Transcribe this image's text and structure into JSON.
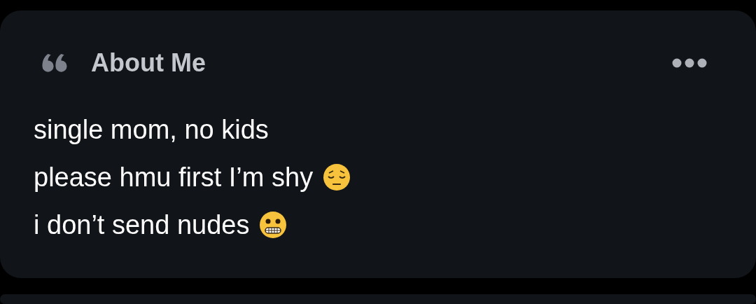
{
  "section": {
    "title": "About Me"
  },
  "lines": [
    {
      "kind": "text",
      "text": "single mom, no kids"
    },
    {
      "kind": "sad",
      "text": "please hmu first I’m shy"
    },
    {
      "kind": "grimace",
      "text": "i don’t send nudes"
    }
  ]
}
